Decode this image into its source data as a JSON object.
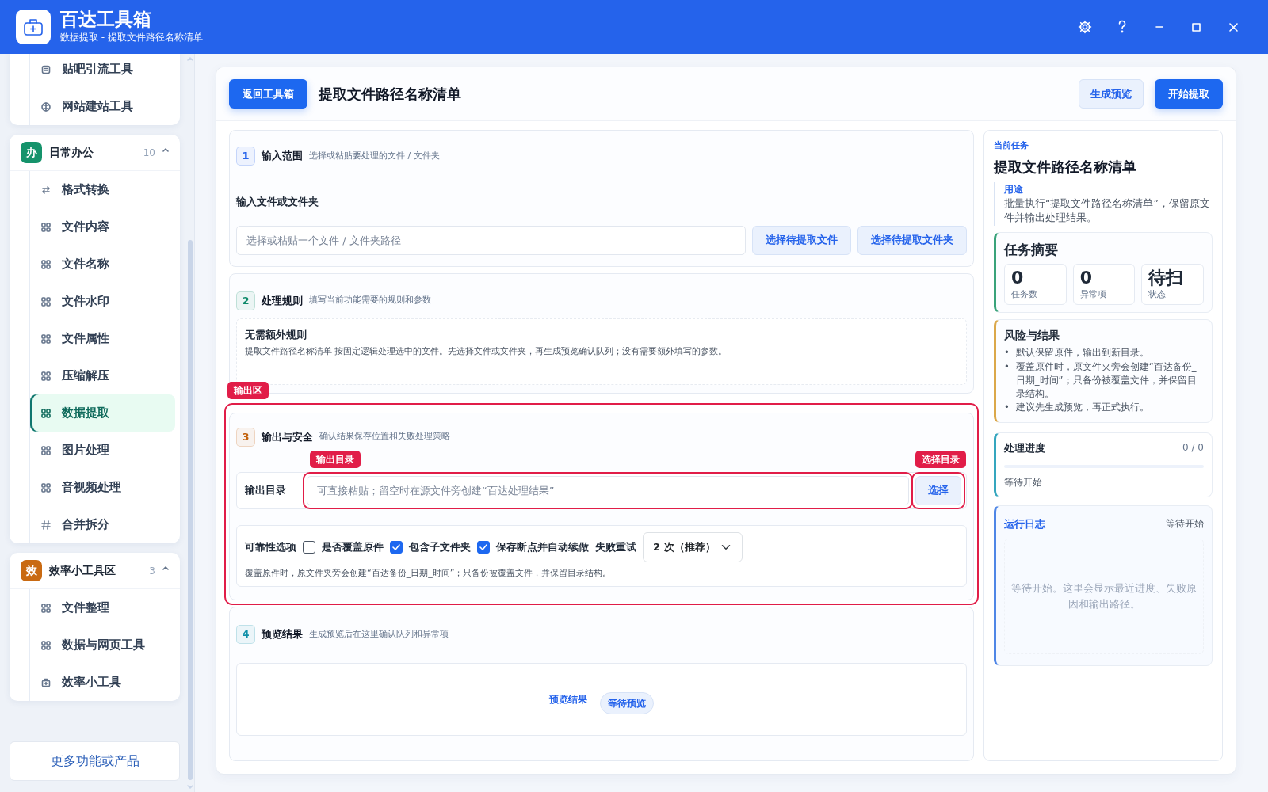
{
  "app": {
    "title": "百达工具箱",
    "subtitle": "数据提取 - 提取文件路径名称清单"
  },
  "sidebar": {
    "groups": [
      {
        "items": [
          {
            "label": "贴吧引流工具",
            "kind": "doc",
            "selected": false
          },
          {
            "label": "网站建站工具",
            "kind": "globe",
            "selected": false
          }
        ]
      },
      {
        "badge": "办",
        "name": "日常办公",
        "count": "10",
        "color": "#15936b",
        "expanded": true,
        "items": [
          {
            "label": "格式转换",
            "kind": "swap",
            "selected": false
          },
          {
            "label": "文件内容",
            "kind": "grid",
            "selected": false
          },
          {
            "label": "文件名称",
            "kind": "grid",
            "selected": false
          },
          {
            "label": "文件水印",
            "kind": "grid",
            "selected": false
          },
          {
            "label": "文件属性",
            "kind": "grid",
            "selected": false
          },
          {
            "label": "压缩解压",
            "kind": "grid",
            "selected": false
          },
          {
            "label": "数据提取",
            "kind": "grid",
            "selected": true
          },
          {
            "label": "图片处理",
            "kind": "grid",
            "selected": false
          },
          {
            "label": "音视频处理",
            "kind": "grid",
            "selected": false
          },
          {
            "label": "合并拆分",
            "kind": "hash",
            "selected": false
          }
        ]
      },
      {
        "badge": "效",
        "name": "效率小工具区",
        "count": "3",
        "color": "#c96a12",
        "expanded": true,
        "items": [
          {
            "label": "文件整理",
            "kind": "grid",
            "selected": false
          },
          {
            "label": "数据与网页工具",
            "kind": "grid",
            "selected": false
          },
          {
            "label": "效率小工具",
            "kind": "toolbox",
            "selected": false
          }
        ]
      }
    ],
    "more_button": "更多功能或产品"
  },
  "toolbar": {
    "back_button": "返回工具箱",
    "title": "提取文件路径名称清单",
    "buttons": [
      {
        "label": "生成预览",
        "kind": "secondary"
      },
      {
        "label": "开始提取",
        "kind": "primary"
      }
    ]
  },
  "sections": [
    {
      "kind": "input",
      "number": "1",
      "title": "输入范围",
      "hint": "选择或粘贴要处理的文件 / 文件夹",
      "color": "#2563eb",
      "field_label": "输入文件或文件夹",
      "placeholder": "选择或粘贴一个文件 / 文件夹路径",
      "buttons": [
        "选择待提取文件",
        "选择待提取文件夹"
      ]
    },
    {
      "kind": "rules",
      "number": "2",
      "title": "处理规则",
      "hint": "填写当前功能需要的规则和参数",
      "color": "#0f8a6a",
      "rule_title": "无需额外规则",
      "rule_text": "提取文件路径名称清单 按固定逻辑处理选中的文件。先选择文件或文件夹，再生成预览确认队列；没有需要额外填写的参数。"
    },
    {
      "kind": "output",
      "number": "3",
      "title": "输出与安全",
      "hint": "确认结果保存位置和失败处理策略",
      "color": "#c2610c",
      "annotation": "输出区",
      "output_label": "输出目录",
      "placeholder": "可直接粘贴；留空时在源文件旁创建“百达处理结果”",
      "field_annotation": "输出目录",
      "select_button": "选择",
      "button_annotation": "选择目录",
      "options_label": "可靠性选项",
      "options": [
        {
          "label": "是否覆盖原件",
          "checked": false
        },
        {
          "label": "包含子文件夹",
          "checked": true
        },
        {
          "label": "保存断点并自动续做",
          "checked": true
        }
      ],
      "retry_label": "失败重试",
      "retry_value": "2 次（推荐）",
      "note": "覆盖原件时，原文件夹旁会创建“百达备份_日期_时间”；只备份被覆盖文件，并保留目录结构。"
    },
    {
      "kind": "preview",
      "number": "4",
      "title": "预览结果",
      "hint": "生成预览后在这里确认队列和异常项",
      "color": "#0e8fa8",
      "preview_label": "预览结果",
      "status": "等待预览"
    }
  ],
  "task": {
    "eyebrow": "当前任务",
    "title": "提取文件路径名称清单",
    "purpose_label": "用途",
    "purpose": "批量执行“提取文件路径名称清单”，保留原文件并输出处理结果。"
  },
  "summary": {
    "title": "任务摘要",
    "stats": [
      {
        "value": "0",
        "label": "任务数"
      },
      {
        "value": "0",
        "label": "异常项"
      },
      {
        "value": "待扫",
        "label": "状态"
      }
    ]
  },
  "risks": {
    "title": "风险与结果",
    "items": [
      {
        "marker": "•",
        "text": "默认保留原件，输出到新目录。"
      },
      {
        "marker": "•",
        "text": "覆盖原件时，原文件夹旁会创建“百达备份_日期_时间”；只备份被覆盖文件，并保留目录结构。"
      },
      {
        "marker": "•",
        "text": "建议先生成预览，再正式执行。"
      }
    ]
  },
  "progress": {
    "title": "处理进度",
    "count": "0 / 0",
    "level": 0,
    "status": "等待开始"
  },
  "log": {
    "title": "运行日志",
    "status": "等待开始",
    "empty": "等待开始。这里会显示最近进度、失败原因和输出路径。"
  }
}
